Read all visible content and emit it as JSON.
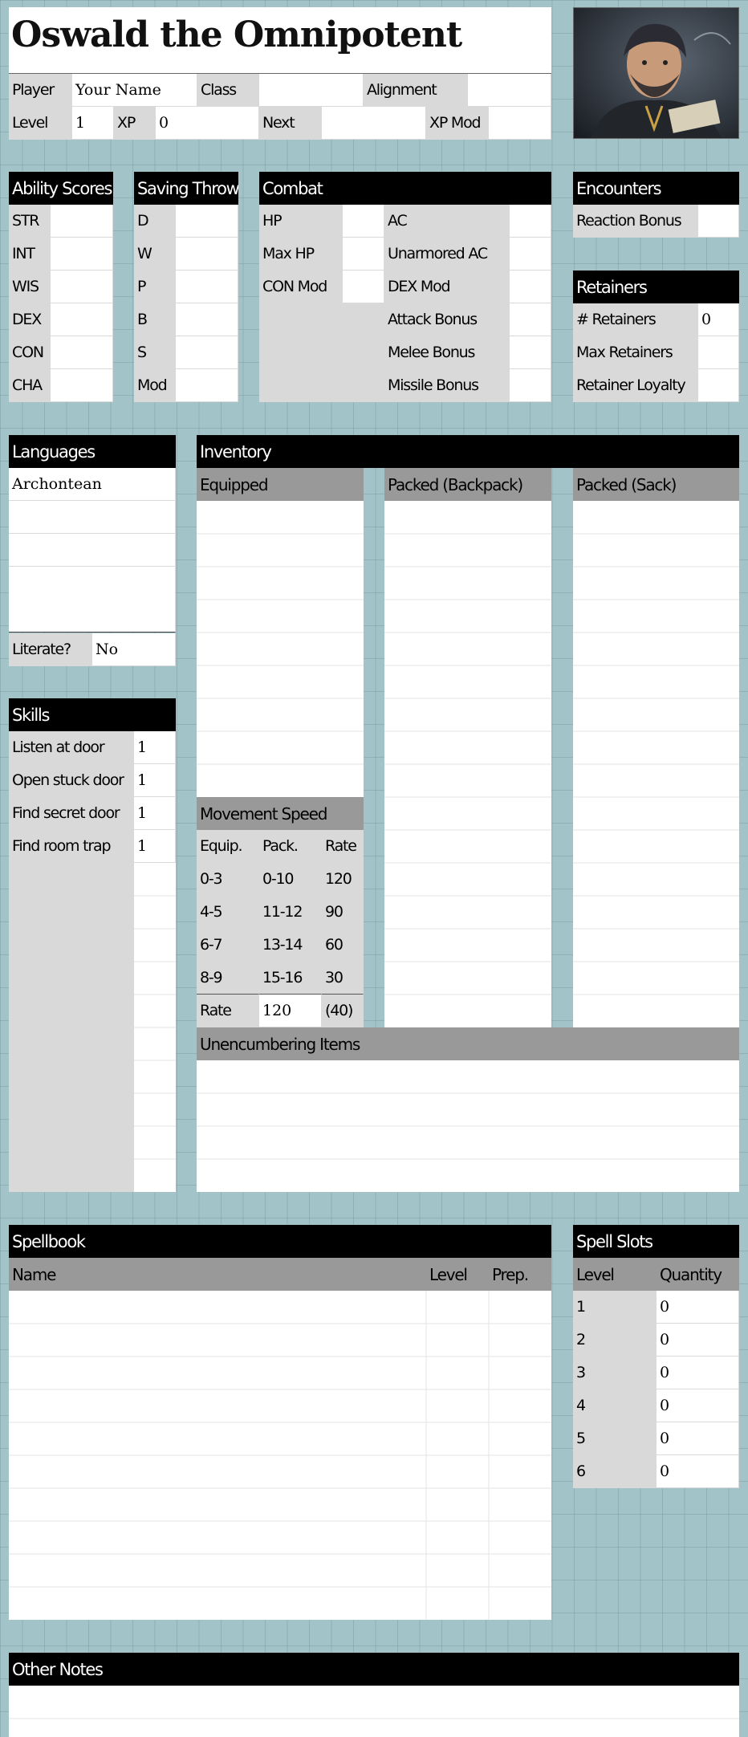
{
  "character": {
    "name": "Oswald the Omnipotent",
    "player_label": "Player",
    "player_value": "Your Name",
    "class_label": "Class",
    "class_value": "",
    "alignment_label": "Alignment",
    "alignment_value": "",
    "level_label": "Level",
    "level_value": "1",
    "xp_label": "XP",
    "xp_value": "0",
    "next_label": "Next",
    "next_value": "",
    "xpmod_label": "XP Mod",
    "xpmod_value": ""
  },
  "abilities": {
    "header": "Ability Scores",
    "items": [
      "STR",
      "INT",
      "WIS",
      "DEX",
      "CON",
      "CHA"
    ]
  },
  "saves": {
    "header": "Saving Throws",
    "items": [
      "D",
      "W",
      "P",
      "B",
      "S",
      "Mod"
    ]
  },
  "combat": {
    "header": "Combat",
    "left": [
      "HP",
      "Max HP",
      "CON Mod"
    ],
    "right": [
      "AC",
      "Unarmored AC",
      "DEX Mod",
      "Attack Bonus",
      "Melee Bonus",
      "Missile Bonus"
    ]
  },
  "encounters": {
    "header": "Encounters",
    "reaction_label": "Reaction Bonus"
  },
  "retainers": {
    "header": "Retainers",
    "count_label": "# Retainers",
    "count_value": "0",
    "max_label": "Max Retainers",
    "loyalty_label": "Retainer Loyalty"
  },
  "languages": {
    "header": "Languages",
    "first": "Archontean",
    "literate_label": "Literate?",
    "literate_value": "No"
  },
  "skills": {
    "header": "Skills",
    "items": [
      {
        "name": "Listen at door",
        "value": "1"
      },
      {
        "name": "Open stuck door",
        "value": "1"
      },
      {
        "name": "Find secret door",
        "value": "1"
      },
      {
        "name": "Find room trap",
        "value": "1"
      }
    ]
  },
  "inventory": {
    "header": "Inventory",
    "equipped": "Equipped",
    "backpack": "Packed (Backpack)",
    "sack": "Packed (Sack)",
    "unencumbering": "Unencumbering Items"
  },
  "movement": {
    "header": "Movement Speed",
    "cols": [
      "Equip.",
      "Pack.",
      "Rate"
    ],
    "rows": [
      [
        "0-3",
        "0-10",
        "120"
      ],
      [
        "4-5",
        "11-12",
        "90"
      ],
      [
        "6-7",
        "13-14",
        "60"
      ],
      [
        "8-9",
        "15-16",
        "30"
      ]
    ],
    "rate_label": "Rate",
    "rate_value": "120",
    "rate_enc": "(40)"
  },
  "spellbook": {
    "header": "Spellbook",
    "col_name": "Name",
    "col_level": "Level",
    "col_prep": "Prep."
  },
  "spell_slots": {
    "header": "Spell Slots",
    "col_level": "Level",
    "col_qty": "Quantity",
    "rows": [
      [
        "1",
        "0"
      ],
      [
        "2",
        "0"
      ],
      [
        "3",
        "0"
      ],
      [
        "4",
        "0"
      ],
      [
        "5",
        "0"
      ],
      [
        "6",
        "0"
      ]
    ]
  },
  "notes": {
    "header": "Other Notes"
  }
}
